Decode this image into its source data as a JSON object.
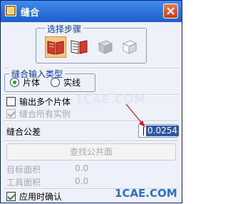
{
  "window": {
    "title": "缝合",
    "close_label": "X"
  },
  "step_group": {
    "title": "选择步骤",
    "icons": [
      {
        "name": "sheet-open-book-icon",
        "state": "active"
      },
      {
        "name": "tool-sheet-book-icon",
        "state": "normal"
      },
      {
        "name": "target-solid-cube-icon",
        "state": "disabled"
      },
      {
        "name": "tool-solid-cube-icon",
        "state": "disabled"
      }
    ]
  },
  "type_group": {
    "title": "缝合输入类型",
    "options": [
      {
        "label": "片体",
        "checked": true
      },
      {
        "label": "实线",
        "checked": false
      }
    ]
  },
  "output_multiple": {
    "label": "输出多个片体",
    "checked": false
  },
  "stitch_all": {
    "label": "缝合所有实例",
    "checked": true,
    "disabled": true
  },
  "tolerance": {
    "label": "缝合公差",
    "value": "0.0254"
  },
  "find_faces": {
    "label": "查找公共面"
  },
  "target_area": {
    "label": "目标面积",
    "value": "0.0"
  },
  "tool_area": {
    "label": "工具面积",
    "value": "0.0"
  },
  "confirm_apply": {
    "label": "应用时确认",
    "checked": true
  },
  "watermarks": {
    "corner": "1CAE.COM",
    "center": "1CAE.COM"
  },
  "colors": {
    "titlebar": "#1e5ec9",
    "highlight": "#2e56a8",
    "accent_green": "#2c9a2c"
  }
}
